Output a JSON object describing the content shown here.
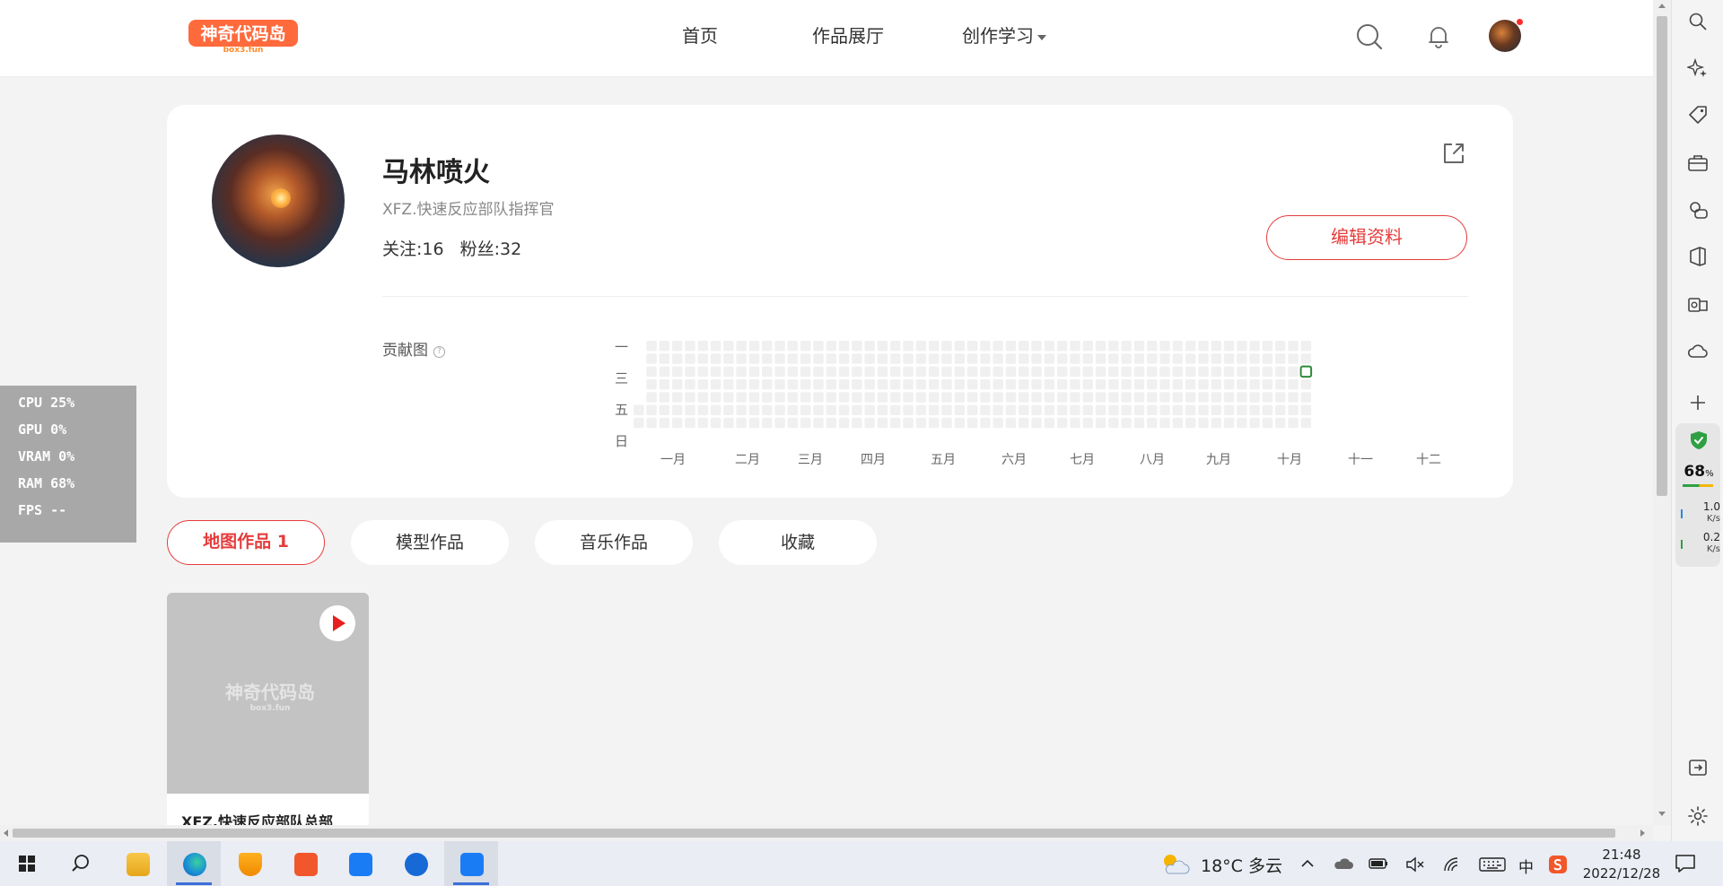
{
  "colors": {
    "accent": "#e63c3c",
    "contrib_empty": "#f0f0f0",
    "contrib_today": "#2e8b3a",
    "page_bg": "#f3f3f3"
  },
  "nav": {
    "logo_text": "神奇代码岛",
    "logo_sub": "box3.fun",
    "items": [
      "首页",
      "作品展厅",
      "创作学习"
    ],
    "icons": [
      "search-icon",
      "bell-icon",
      "avatar"
    ]
  },
  "profile": {
    "name": "马林喷火",
    "signature": "XFZ.快速反应部队指挥官",
    "follow": "关注:16",
    "fans": "粉丝:32",
    "edit_button": "编辑资料",
    "contrib_title": "贡献图",
    "contrib_help": "?",
    "day_labels": [
      "一",
      "三",
      "五",
      "日"
    ],
    "month_labels": [
      "一月",
      "二月",
      "三月",
      "四月",
      "五月",
      "六月",
      "七月",
      "八月",
      "九月",
      "十月",
      "十一",
      "十二"
    ],
    "contrib_highlight_week": 52,
    "contrib_highlight_day": 2
  },
  "tabs": [
    "地图作品 1",
    "模型作品",
    "音乐作品",
    "收藏"
  ],
  "works": [
    {
      "title": "XFZ.快速反应部队总部",
      "watermark": "神奇代码岛",
      "watermark_sub": "box3.fun"
    }
  ],
  "perf": {
    "cpu": "CPU  25%",
    "gpu": "GPU   0%",
    "vram": "VRAM   0%",
    "ram": "RAM  68%",
    "fps": "FPS --"
  },
  "sidebar": {
    "icons": [
      "search-icon",
      "sparkle-icon",
      "tag-icon",
      "toolbox-icon",
      "games-icon",
      "office-icon",
      "outlook-icon",
      "cloud-icon",
      "plus-icon"
    ],
    "security_pct": "68",
    "security_unit": "%",
    "net_up": "1.0",
    "net_up_unit": "K/s",
    "net_down": "0.2",
    "net_down_unit": "K/s",
    "bottom_icons": [
      "exit-icon",
      "settings-icon"
    ]
  },
  "taskbar": {
    "apps": [
      "windows-start-icon",
      "search-icon",
      "file-explorer-icon",
      "edge-icon",
      "security-icon",
      "media-icon",
      "feishu-icon",
      "kk-icon",
      "feishu-active-icon"
    ],
    "weather": "18°C  多云",
    "ime": "中",
    "time": "21:48",
    "date": "2022/12/28"
  }
}
